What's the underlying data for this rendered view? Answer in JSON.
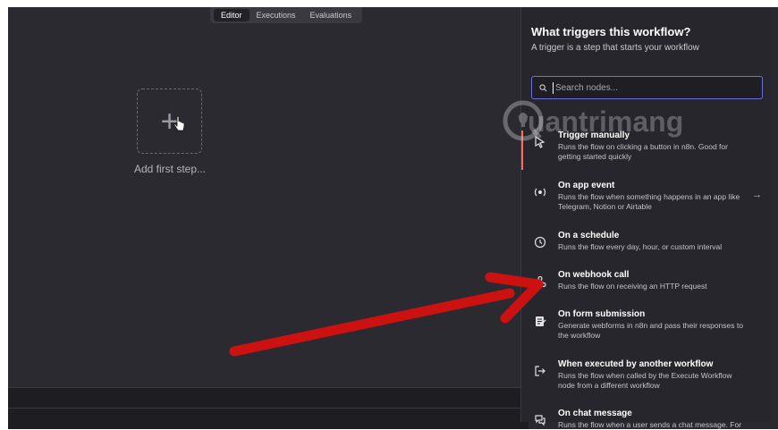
{
  "tabs": [
    {
      "label": "Editor",
      "active": true
    },
    {
      "label": "Executions",
      "active": false
    },
    {
      "label": "Evaluations",
      "active": false
    }
  ],
  "canvas": {
    "add_label": "Add first step..."
  },
  "panel": {
    "title": "What triggers this workflow?",
    "subtitle": "A trigger is a step that starts your workflow",
    "search_placeholder": "Search nodes...",
    "items": [
      {
        "title": "Trigger manually",
        "desc": "Runs the flow on clicking a button in n8n. Good for getting started quickly",
        "icon": "cursor-icon"
      },
      {
        "title": "On app event",
        "desc": "Runs the flow when something happens in an app like Telegram, Notion or Airtable",
        "icon": "app-event-icon",
        "arrow": "→"
      },
      {
        "title": "On a schedule",
        "desc": "Runs the flow every day, hour, or custom interval",
        "icon": "clock-icon"
      },
      {
        "title": "On webhook call",
        "desc": "Runs the flow on receiving an HTTP request",
        "icon": "webhook-icon"
      },
      {
        "title": "On form submission",
        "desc": "Generate webforms in n8n and pass their responses to the workflow",
        "icon": "form-icon"
      },
      {
        "title": "When executed by another workflow",
        "desc": "Runs the flow when called by the Execute Workflow node from a different workflow",
        "icon": "sign-in-icon"
      },
      {
        "title": "On chat message",
        "desc": "Runs the flow when a user sends a chat message. For",
        "icon": "chat-icon"
      }
    ]
  },
  "watermark": {
    "text": "uantrimang"
  },
  "colors": {
    "accent": "#ff6d5a",
    "focus": "#6f6fd9",
    "arrow": "#cc1111"
  }
}
